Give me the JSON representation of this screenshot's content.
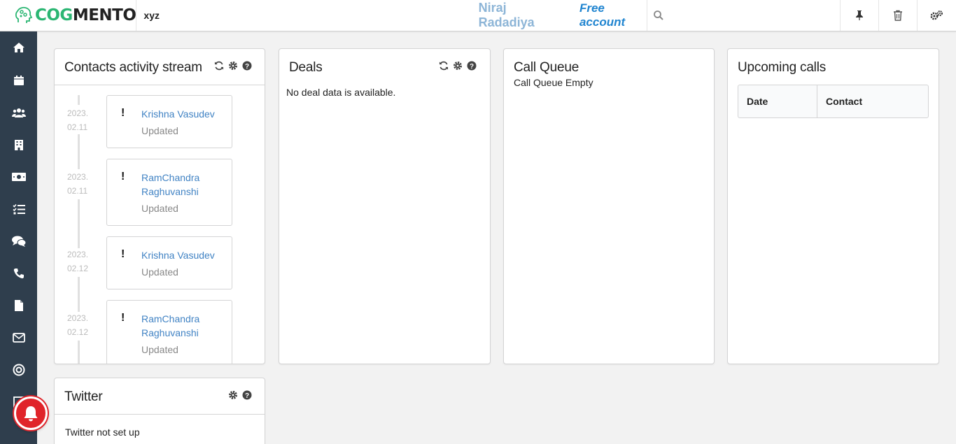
{
  "header": {
    "logo_text_a": "COG",
    "logo_text_b": "MENTO",
    "company": "xyz",
    "user_name": "Niraj Radadiya",
    "account_type": "Free account"
  },
  "sidebar": {
    "items": [
      "home-icon",
      "calendar-icon",
      "contacts-icon",
      "companies-icon",
      "deals-icon",
      "tasks-icon",
      "cases-icon",
      "calls-icon",
      "documents-icon",
      "email-icon",
      "campaigns-icon",
      "forms-icon"
    ]
  },
  "activity_stream": {
    "title": "Contacts activity stream",
    "entries": [
      {
        "date_a": "2023.",
        "date_b": "02.11",
        "name": "Krishna Vasudev",
        "action": "Updated"
      },
      {
        "date_a": "2023.",
        "date_b": "02.11",
        "name": "RamChandra Raghuvanshi",
        "action": "Updated"
      },
      {
        "date_a": "2023.",
        "date_b": "02.12",
        "name": "Krishna Vasudev",
        "action": "Updated"
      },
      {
        "date_a": "2023.",
        "date_b": "02.12",
        "name": "RamChandra Raghuvanshi",
        "action": "Updated"
      }
    ]
  },
  "deals": {
    "title": "Deals",
    "empty": "No deal data is available."
  },
  "call_queue": {
    "title": "Call Queue",
    "empty": "Call Queue Empty"
  },
  "upcoming_calls": {
    "title": "Upcoming calls",
    "col_date": "Date",
    "col_contact": "Contact"
  },
  "twitter": {
    "title": "Twitter",
    "empty": "Twitter not set up"
  },
  "colors": {
    "brand_green": "#2bb673",
    "sidebar": "#2f3e4d",
    "link_blue": "#4183c4",
    "alert_red": "#e0242a"
  }
}
